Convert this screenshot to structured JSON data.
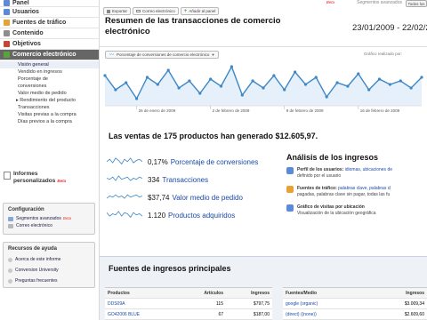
{
  "sidebar": {
    "nav": [
      {
        "label": "Panel",
        "icon": "dashboard-icon",
        "color": "#5c8ad8",
        "active": false
      },
      {
        "label": "Usuarios",
        "icon": "users-icon",
        "color": "#5c8ad8",
        "active": false
      },
      {
        "label": "Fuentes de tráfico",
        "icon": "traffic-icon",
        "color": "#e8a133",
        "active": false
      },
      {
        "label": "Contenido",
        "icon": "content-icon",
        "color": "#8e8e8e",
        "active": false
      },
      {
        "label": "Objetivos",
        "icon": "goals-icon",
        "color": "#c84434",
        "active": false
      },
      {
        "label": "Comercio electrónico",
        "icon": "ecommerce-icon",
        "color": "#5aa23a",
        "active": true
      }
    ],
    "sub_items": [
      {
        "label": "Visión general",
        "selected": true,
        "level": "sub"
      },
      {
        "label": "Vendido en ingresos",
        "selected": false,
        "level": "sub"
      },
      {
        "label": "Porcentaje de",
        "selected": false,
        "level": "sub"
      },
      {
        "label": "conversiones",
        "selected": false,
        "level": "sub"
      },
      {
        "label": "Valor medio de pedido",
        "selected": false,
        "level": "sub"
      },
      {
        "label": "▸ Rendimiento del producto",
        "selected": false,
        "level": "grp"
      },
      {
        "label": "Transacciones",
        "selected": false,
        "level": "sub"
      },
      {
        "label": "Visitas previas a la compra",
        "selected": false,
        "level": "sub"
      },
      {
        "label": "Días previos a la compra",
        "selected": false,
        "level": "sub"
      }
    ],
    "custom_reports": {
      "label_line1": "Informes",
      "label_line2": "personalizados",
      "badge": "Beta"
    },
    "config": {
      "title": "Configuración",
      "links": [
        {
          "label": "Segmentos avanzados",
          "badge": "Beta",
          "icon": "segments-icon"
        },
        {
          "label": "Correo electrónico",
          "badge": "",
          "icon": "email-icon"
        }
      ]
    },
    "help": {
      "title": "Recursos de ayuda",
      "links": [
        {
          "label": "Acerca de este informe",
          "icon": "info-icon"
        },
        {
          "label": "Conversion University",
          "icon": "university-icon"
        },
        {
          "label": "Preguntas frecuentes",
          "icon": "faq-icon"
        }
      ]
    }
  },
  "topbar": {
    "badge": "Beta",
    "text": "Segmentos avanzados",
    "button": "Todos los"
  },
  "toolbar": {
    "buttons": [
      "Exportar",
      "Correo electrónico",
      "Añadir al panel"
    ]
  },
  "header": {
    "title": "Resumen de las transacciones de comercio electrónico",
    "date_range": "23/01/2009 - 22/02/2"
  },
  "chart_ctrl": {
    "label": "Porcentaje de conversiones de comercio electrónico",
    "group_label": "Gráfico realizado por:"
  },
  "chart_data": {
    "type": "line",
    "series": [
      {
        "values": [
          0.22,
          0.14,
          0.18,
          0.09,
          0.21,
          0.17,
          0.25,
          0.15,
          0.19,
          0.12,
          0.2,
          0.16,
          0.27,
          0.11,
          0.19,
          0.15,
          0.22,
          0.14,
          0.24,
          0.17,
          0.21,
          0.1,
          0.18,
          0.16,
          0.23,
          0.14,
          0.2,
          0.17,
          0.19,
          0.15,
          0.21
        ]
      }
    ],
    "x_tick_labels": [
      "26 de enero de 2009",
      "2 de febrero de 2009",
      "9 de febrero de 2009",
      "16 de febrero de 2009"
    ],
    "line_color": "#3d87c7"
  },
  "headline": "Las ventas de 175 productos han generado $12.605,97.",
  "metrics": [
    {
      "value": "0,17%",
      "label": "Porcentaje de conversiones"
    },
    {
      "value": "334",
      "label": "Transacciones"
    },
    {
      "value": "$37,74",
      "label": "Valor medio de pedido"
    },
    {
      "value": "1.120",
      "label": "Productos adquiridos"
    }
  ],
  "analysis": {
    "title": "Análisis de los ingresos",
    "items": [
      {
        "icon": "profile-icon",
        "color": "#5c8ad8",
        "lead": "Perfil de los usuarios:",
        "links": "idiomas, ubicaciones de",
        "rest": "definido por el usuario"
      },
      {
        "icon": "sources-icon",
        "color": "#e8a133",
        "lead": "Fuentes de tráfico:",
        "links": "palabras clave, palabras cl",
        "rest": "pagadas, palabras clave sin pagar, todas las fu"
      },
      {
        "icon": "location-chart-icon",
        "color": "#5c8ad8",
        "lead": "Gráfico de visitas por ubicación",
        "links": "",
        "rest": "Visualización de la ubicación geográfica"
      }
    ]
  },
  "fuentes": {
    "title": "Fuentes de ingresos principales",
    "products_table": {
      "headers": [
        "Productos",
        "Artículos",
        "Ingresos"
      ],
      "rows": [
        [
          "DDS09A",
          "115",
          "$797,75"
        ],
        [
          "GO42006 BLUE",
          "67",
          "$187,00"
        ]
      ]
    },
    "sources_table": {
      "headers": [
        "Fuentes/Medio",
        "Ingresos"
      ],
      "rows": [
        [
          "google (organic)",
          "$3.009,34"
        ],
        [
          "(direct) ((none))",
          "$2.609,60"
        ]
      ]
    }
  }
}
